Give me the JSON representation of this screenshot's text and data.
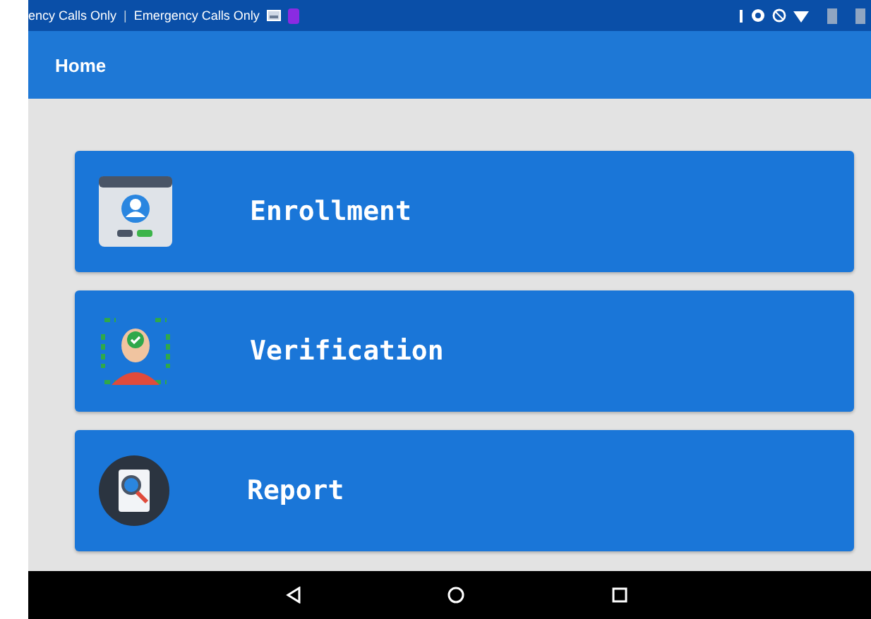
{
  "status_bar": {
    "carrier_text": "ency Calls Only",
    "separator": "|",
    "carrier_text_2": "Emergency Calls Only"
  },
  "app_bar": {
    "title": "Home"
  },
  "menu": [
    {
      "kind": "enrollment",
      "label": "Enrollment"
    },
    {
      "kind": "verification",
      "label": "Verification"
    },
    {
      "kind": "report",
      "label": "Report"
    }
  ]
}
